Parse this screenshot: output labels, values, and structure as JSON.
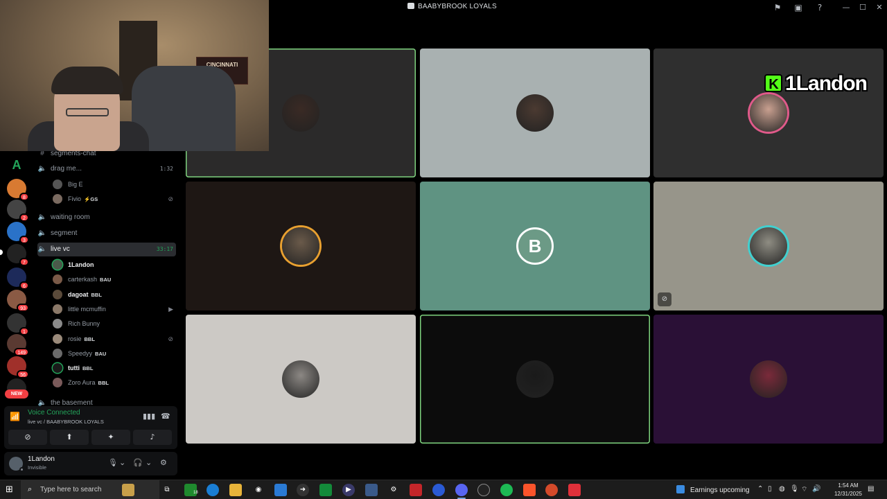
{
  "window": {
    "title": "BAABYBROOK LOYALS"
  },
  "webcam": {
    "banner_text": "CINCINNATI"
  },
  "server_rail": {
    "badges": [
      "",
      "8",
      "2",
      "3",
      "7",
      "6",
      "93",
      "1",
      "149",
      "56",
      ""
    ],
    "first_letter": "A",
    "new_label": "NEW"
  },
  "channels": {
    "text_channel": "segments-chat",
    "drag": {
      "name": "drag me...",
      "time": "1:32"
    },
    "drag_users": [
      {
        "name": "Big E",
        "tag": ""
      },
      {
        "name": "Fivio",
        "tag": "⚡GS"
      }
    ],
    "waiting_room": "waiting room",
    "segment": "segment",
    "live": {
      "name": "live vc",
      "time": "33:17"
    },
    "live_users": [
      {
        "name": "1Landon",
        "tag": ""
      },
      {
        "name": "carterkash",
        "tag": "BAU"
      },
      {
        "name": "dagoat",
        "tag": "BBL"
      },
      {
        "name": "little mcmuffin",
        "tag": ""
      },
      {
        "name": "Rich Bunny",
        "tag": ""
      },
      {
        "name": "rosie",
        "tag": "BBL"
      },
      {
        "name": "Speedyy",
        "tag": "BAU"
      },
      {
        "name": "tutti",
        "tag": "BBL"
      },
      {
        "name": "Zoro Aura",
        "tag": "BBL"
      }
    ],
    "next_channel": "the basement"
  },
  "voice_panel": {
    "status": "Voice Connected",
    "location": "live vc / BAABYBROOK LOYALS"
  },
  "user_panel": {
    "name": "1Landon",
    "status": "Invisible"
  },
  "grid": {
    "b_letter": "B",
    "overlay_name": "1Landon",
    "overlay_k": "K",
    "tiles": [
      {
        "bg": "#2b2a2a",
        "speaking": true,
        "avatar_color": "#3a2a24"
      },
      {
        "bg": "#a9b1b1",
        "speaking": false,
        "avatar_color": "#4b3a31"
      },
      {
        "bg": "#2f2f2f",
        "speaking": false,
        "avatar_color": "#c9a090"
      },
      {
        "bg": "#1e1714",
        "speaking": false,
        "avatar_color": "#6a5a4a"
      },
      {
        "bg": "#5f9382",
        "speaking": false,
        "avatar_color": "#6c9a86"
      },
      {
        "bg": "#97958a",
        "speaking": false,
        "avatar_color": "#8f8d83"
      },
      {
        "bg": "#ccc9c5",
        "speaking": false,
        "avatar_color": "#8c8884"
      },
      {
        "bg": "#0c0c0c",
        "speaking": true,
        "avatar_color": "#1a1a1a"
      },
      {
        "bg": "#2a1036",
        "speaking": false,
        "avatar_color": "#7a2a3a"
      }
    ]
  },
  "taskbar": {
    "search_placeholder": "Type here to search",
    "weather": "Earnings upcoming",
    "time": "1:54 AM",
    "date": "12/31/2025",
    "xbox_badge": "18"
  }
}
